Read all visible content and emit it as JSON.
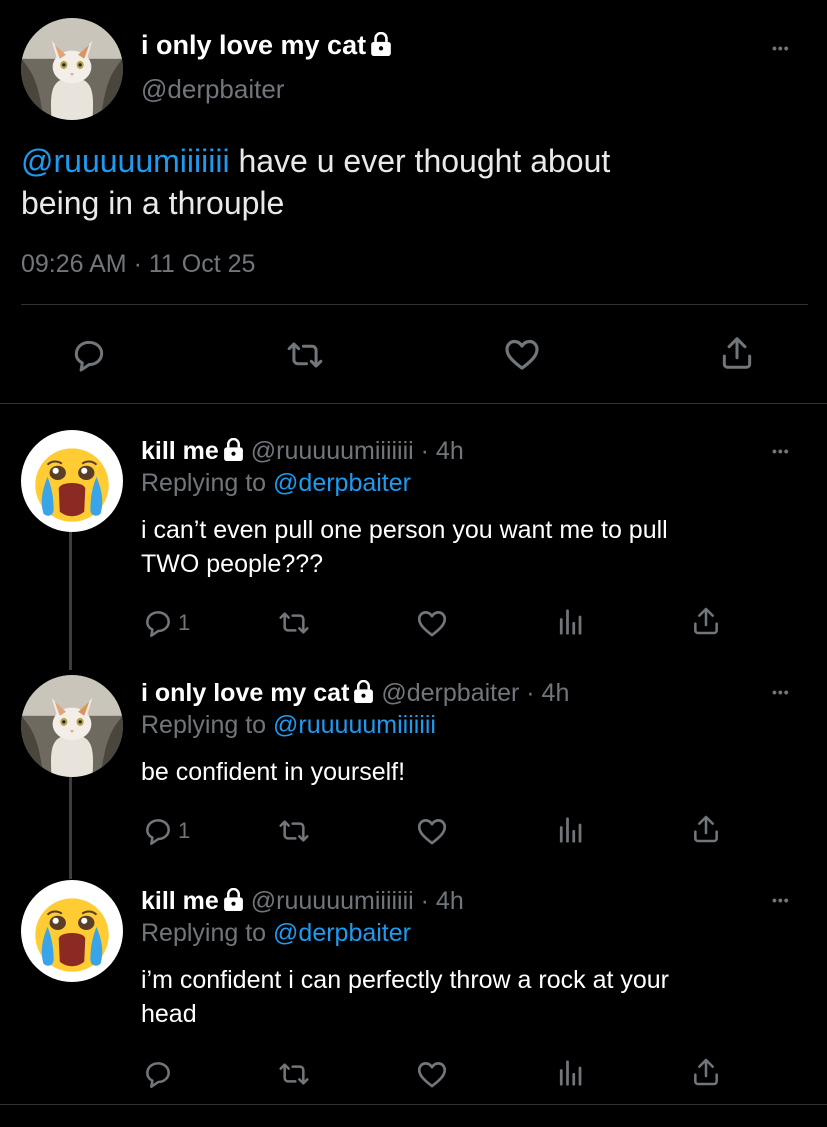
{
  "main_tweet": {
    "display_name": "i only love my cat",
    "handle": "@derpbaiter",
    "mention": "@ruuuuumiiiiiii",
    "text_line1": " have u ever thought about",
    "text_line2": "being in a throuple",
    "timestamp": "09:26 AM · 11 Oct 25"
  },
  "replies": [
    {
      "display_name": "kill me",
      "handle_time": "@ruuuuumiiiiiii · 4h",
      "replying_prefix": "Replying to ",
      "replying_to": "@derpbaiter",
      "text_line1": "i can’t even pull one person you want me to pull",
      "text_line2": "TWO people???",
      "reply_count": "1"
    },
    {
      "display_name": "i only love my cat",
      "handle_time": "@derpbaiter · 4h",
      "replying_prefix": "Replying to ",
      "replying_to": "@ruuuuumiiiiiii",
      "text_line1": "be confident in yourself!",
      "reply_count": "1"
    },
    {
      "display_name": "kill me",
      "handle_time": "@ruuuuumiiiiiii · 4h",
      "replying_prefix": "Replying to ",
      "replying_to": "@derpbaiter",
      "text_line1": "i’m confident i can perfectly throw a rock at your",
      "text_line2": "head",
      "reply_count": ""
    }
  ],
  "more_label": "•••",
  "colors": {
    "link": "#1d9bf0",
    "gray": "#71767b",
    "background": "#000000"
  },
  "icons": [
    "lock-icon",
    "reply-icon",
    "retweet-icon",
    "like-icon",
    "analytics-icon",
    "share-icon",
    "more-icon"
  ]
}
